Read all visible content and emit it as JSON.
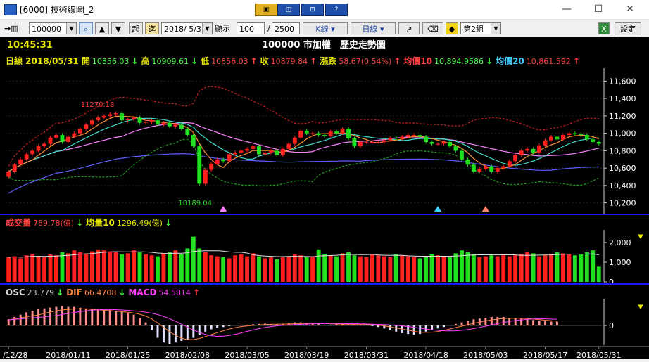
{
  "window": {
    "title": "[6000] 技術線圖_2",
    "buttons": [
      "▣",
      "◫",
      "⊡",
      "?"
    ],
    "controls": [
      "—",
      "☐",
      "✕"
    ]
  },
  "toolbar": {
    "nav_arrow": "→▥",
    "symbol_value": "100000",
    "up_label": "▲",
    "down_label": "▼",
    "start_label": "起",
    "end_label": "迄",
    "date_value": "2018/ 5/31",
    "display_label": "顯示",
    "display_value": "100",
    "sep": "/",
    "total_value": "2500",
    "kline_label": "K線",
    "period_label": "日線",
    "line_tool": "↗",
    "erase_tool": "⌫",
    "group_value": "第2組",
    "excel_label": "X",
    "settings_label": "設定"
  },
  "header": {
    "time": "10:45:31",
    "chart_title": "100000 市加權　歷史走勢圖"
  },
  "info_bar": [
    {
      "label": "日線 2018/05/31 開",
      "value": "10856.03",
      "arrow": "↓",
      "color": "#e8e800"
    },
    {
      "label": "高",
      "value": "10909.61",
      "arrow": "↓",
      "color": "#e8e800"
    },
    {
      "label": "低",
      "value": "10856.03",
      "arrow": "↑",
      "color": "#e8e800"
    },
    {
      "label": "收",
      "value": "10879.84",
      "arrow": "↑",
      "color": "#e8e800"
    },
    {
      "label": "漲跌",
      "value": "58.67(0.54%)",
      "arrow": "↑",
      "color": "#e8e800"
    },
    {
      "label": "均價10",
      "value": "10,894.9586",
      "arrow": "↓",
      "color": "#ff4040"
    },
    {
      "label": "均價20",
      "value": "10,861.592",
      "arrow": "↑",
      "color": "#40d0ff"
    }
  ],
  "volume_bar": [
    {
      "label": "成交量",
      "value": "769.78(億)",
      "arrow": "↓",
      "color": "#ff4040"
    },
    {
      "label": "均量10",
      "value": "1296.49(億)",
      "arrow": "↓",
      "color": "#e8e800"
    }
  ],
  "macd_bar": [
    {
      "label": "OSC",
      "value": "23.779",
      "arrow": "↓",
      "color": "#d0d0d0"
    },
    {
      "label": "DIF",
      "value": "66.4708",
      "arrow": "↓",
      "color": "#ff8040"
    },
    {
      "label": "MACD",
      "value": "54.5814",
      "arrow": "↑",
      "color": "#ff40ff"
    }
  ],
  "chart_data": {
    "type": "candlestick",
    "price_axis": {
      "ticks": [
        "11,600",
        "11,400",
        "11,200",
        "11,000",
        "10,800",
        "10,600",
        "10,400",
        "10,200"
      ],
      "ylim": [
        10100,
        11700
      ]
    },
    "volume_axis": {
      "ticks": [
        "2,000",
        "1,000",
        "0"
      ],
      "ylim": [
        0,
        2500
      ]
    },
    "macd_axis": {
      "ticks": [
        "0"
      ],
      "ylim": [
        -150,
        150
      ]
    },
    "x_ticks": [
      "/12/28",
      "2018/01/11",
      "2018/01/25",
      "2018/02/08",
      "2018/03/05",
      "2018/03/19",
      "2018/03/31",
      "2018/04/18",
      "2018/05/03",
      "2018/05/17",
      "2018/05/31"
    ],
    "annotations": {
      "high": "11270.18",
      "low": "10189.04"
    },
    "close": [
      10560,
      10640,
      10700,
      10760,
      10800,
      10850,
      10880,
      10950,
      10980,
      10900,
      10960,
      11000,
      11050,
      11100,
      11150,
      11180,
      11200,
      11220,
      11230,
      11150,
      11160,
      11180,
      11120,
      11130,
      11150,
      11100,
      11120,
      11080,
      11100,
      11050,
      10980,
      10850,
      10420,
      10580,
      10650,
      10700,
      10680,
      10760,
      10780,
      10800,
      10820,
      10850,
      10760,
      10780,
      10800,
      10750,
      10820,
      10880,
      10950,
      11030,
      11000,
      11000,
      10980,
      10970,
      11020,
      11000,
      11050,
      10940,
      10850,
      10900,
      10900,
      10900,
      10900,
      10920,
      10950,
      10940,
      10960,
      10980,
      10980,
      10960,
      10900,
      10880,
      10880,
      10900,
      10850,
      10800,
      10700,
      10640,
      10560,
      10590,
      10620,
      10560,
      10600,
      10620,
      10680,
      10750,
      10800,
      10820,
      10780,
      10860,
      10920,
      10960,
      10930,
      10980,
      11000,
      10990,
      10980,
      10930,
      10900,
      10880
    ],
    "open": [
      10500,
      10560,
      10640,
      10700,
      10760,
      10800,
      10850,
      10880,
      10950,
      10980,
      10900,
      10960,
      11000,
      11050,
      11100,
      11150,
      11180,
      11200,
      11220,
      11230,
      11150,
      11160,
      11180,
      11120,
      11130,
      11150,
      11100,
      11120,
      11080,
      11100,
      11050,
      10980,
      10850,
      10420,
      10580,
      10650,
      10700,
      10680,
      10760,
      10780,
      10800,
      10820,
      10850,
      10760,
      10780,
      10800,
      10750,
      10820,
      10880,
      10950,
      11030,
      11000,
      11000,
      10980,
      10970,
      11020,
      11000,
      11050,
      10940,
      10850,
      10900,
      10900,
      10900,
      10900,
      10920,
      10950,
      10940,
      10960,
      10980,
      10980,
      10960,
      10900,
      10880,
      10880,
      10900,
      10850,
      10800,
      10700,
      10640,
      10560,
      10590,
      10620,
      10560,
      10600,
      10620,
      10680,
      10750,
      10800,
      10820,
      10780,
      10860,
      10920,
      10960,
      10930,
      10980,
      11000,
      10990,
      10980,
      10930,
      10900
    ],
    "volume": [
      1250,
      1300,
      1200,
      1350,
      1400,
      1300,
      1250,
      1400,
      1350,
      1500,
      1450,
      1600,
      1500,
      1450,
      1550,
      1650,
      1600,
      1550,
      1500,
      1400,
      1450,
      1600,
      1500,
      1400,
      1350,
      1300,
      1450,
      1500,
      1600,
      1400,
      1700,
      2300,
      1700,
      1500,
      1350,
      1300,
      1250,
      1200,
      1350,
      1400,
      1300,
      1450,
      1300,
      1200,
      1250,
      1150,
      1250,
      1300,
      1400,
      1350,
      1250,
      1300,
      1650,
      1400,
      1350,
      1300,
      1450,
      1500,
      1350,
      1300,
      1250,
      1400,
      1350,
      1300,
      1250,
      1400,
      1350,
      1300,
      1250,
      1200,
      1250,
      1400,
      1350,
      1300,
      1250,
      1450,
      1600,
      1500,
      1400,
      1250,
      1300,
      1350,
      1300,
      1350,
      1300,
      1350,
      1400,
      1500,
      1450,
      1300,
      1350,
      1400,
      1500,
      1450,
      1400,
      1350,
      1400,
      1500,
      1600,
      770
    ],
    "osc": [
      40,
      55,
      70,
      85,
      95,
      105,
      110,
      115,
      120,
      125,
      120,
      120,
      115,
      110,
      105,
      105,
      100,
      100,
      95,
      90,
      80,
      70,
      50,
      20,
      -30,
      -80,
      -110,
      -120,
      -110,
      -100,
      -90,
      -80,
      -60,
      -40,
      -25,
      -15,
      -10,
      -5,
      0,
      5,
      5,
      8,
      10,
      12,
      10,
      8,
      10,
      15,
      20,
      20,
      18,
      15,
      10,
      5,
      5,
      8,
      10,
      12,
      10,
      5,
      0,
      -5,
      -10,
      -20,
      -30,
      -40,
      -50,
      -55,
      -60,
      -55,
      -40,
      -30,
      -20,
      -10,
      0,
      10,
      20,
      30,
      40,
      45,
      50,
      55,
      55,
      55,
      50,
      50,
      45,
      40,
      35,
      30,
      28,
      25,
      24
    ]
  }
}
